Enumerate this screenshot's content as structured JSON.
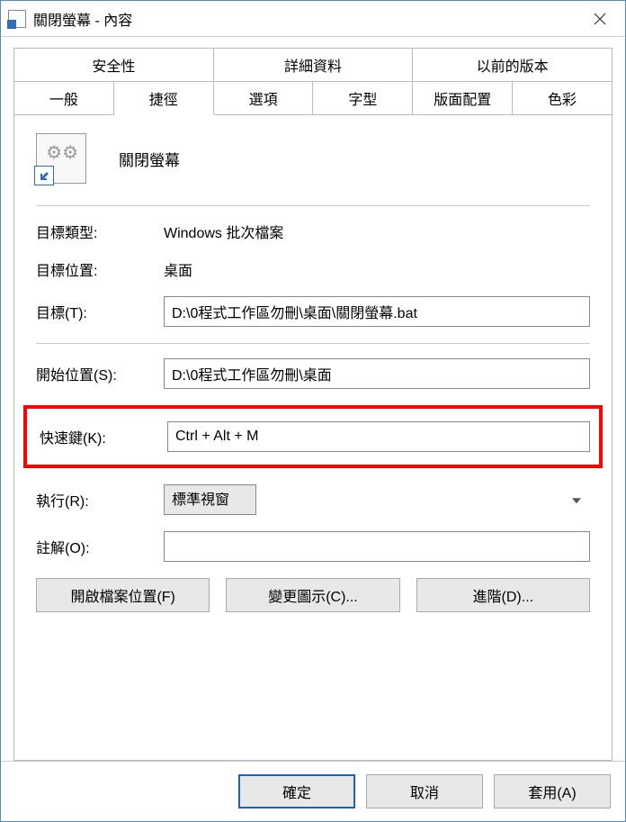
{
  "window": {
    "title": "關閉螢幕 - 內容"
  },
  "tabs": {
    "row1": [
      "安全性",
      "詳細資料",
      "以前的版本"
    ],
    "row2": [
      "一般",
      "捷徑",
      "選項",
      "字型",
      "版面配置",
      "色彩"
    ],
    "active": "捷徑"
  },
  "shortcut": {
    "name": "關閉螢幕",
    "target_type_label": "目標類型:",
    "target_type_value": "Windows 批次檔案",
    "target_location_label": "目標位置:",
    "target_location_value": "桌面",
    "target_label": "目標(T):",
    "target_value": "D:\\0程式工作區勿刪\\桌面\\關閉螢幕.bat",
    "start_in_label": "開始位置(S):",
    "start_in_value": "D:\\0程式工作區勿刪\\桌面",
    "shortcut_key_label": "快速鍵(K):",
    "shortcut_key_value": "Ctrl + Alt + M",
    "run_label": "執行(R):",
    "run_value": "標準視窗",
    "comment_label": "註解(O):",
    "comment_value": ""
  },
  "buttons": {
    "open_file_location": "開啟檔案位置(F)",
    "change_icon": "變更圖示(C)...",
    "advanced": "進階(D)...",
    "ok": "確定",
    "cancel": "取消",
    "apply": "套用(A)"
  }
}
